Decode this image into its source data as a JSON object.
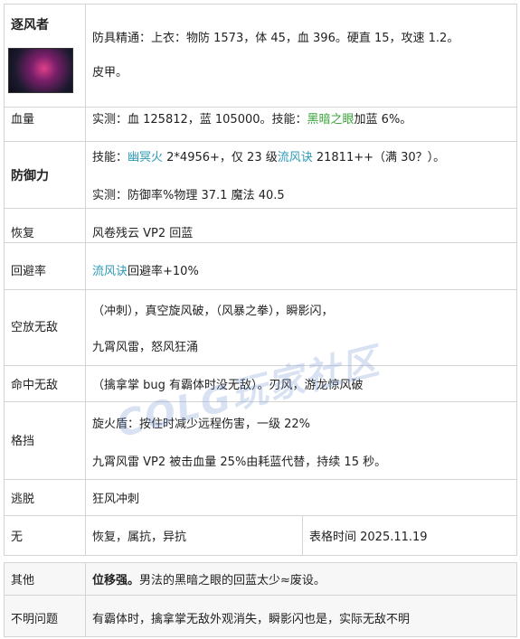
{
  "rows": [
    {
      "label": "逐风者",
      "lines": [
        [
          {
            "t": "防具精通：上衣：物防 1573，体 45，血 396。硬直 15，攻速 1.2。"
          }
        ],
        [
          {
            "t": "皮甲。"
          }
        ]
      ]
    },
    {
      "label": "血量",
      "lines": [
        [
          {
            "t": "实测：血 125812，蓝 105000。技能："
          },
          {
            "t": "黑暗之眼",
            "c": "hl-green"
          },
          {
            "t": "加蓝 6%。"
          }
        ]
      ]
    },
    {
      "label": "防御力",
      "lines": [
        [
          {
            "t": "技能："
          },
          {
            "t": "幽冥火",
            "c": "hl"
          },
          {
            "t": " 2*4956+，仅 23 级"
          },
          {
            "t": "流风诀",
            "c": "hl"
          },
          {
            "t": " 21811++（满 30？）。"
          }
        ],
        [
          {
            "t": "实测：防御率%物理 37.1 魔法 40.5"
          }
        ]
      ]
    },
    {
      "label": "恢复",
      "lines": [
        [
          {
            "t": "风卷残云 VP2 回蓝"
          }
        ]
      ]
    },
    {
      "label": "回避率",
      "lines": [
        [
          {
            "t": "流风诀",
            "c": "hl"
          },
          {
            "t": "回避率+10%"
          }
        ]
      ]
    },
    {
      "label": "空放无敌",
      "lines": [
        [
          {
            "t": "（冲刺），真空旋风破，（风暴之拳），瞬影闪，"
          }
        ],
        [
          {
            "t": "九霄风雷，怒风狂涌"
          }
        ]
      ]
    },
    {
      "label": "命中无敌",
      "lines": [
        [
          {
            "t": "（擒拿掌 bug 有霸体时没无敌）。刃风，游龙惊风破"
          }
        ]
      ]
    },
    {
      "label": "格挡",
      "lines": [
        [
          {
            "t": "旋火盾：按住时减少远程伤害，一级 22%"
          }
        ],
        [
          {
            "t": "九霄风雷 VP2 被击血量 25%由耗蓝代替，持续 15 秒。"
          }
        ]
      ]
    },
    {
      "label": "逃脱",
      "lines": [
        [
          {
            "t": "狂风冲刺"
          }
        ]
      ]
    },
    {
      "label": "无",
      "lines": [
        [
          {
            "t": "恢复，属抗，异抗"
          }
        ]
      ],
      "extra": "表格时间 2025.11.19"
    },
    {
      "label": "其他",
      "lines": [
        [
          {
            "t": "位移强。",
            "c": "bold"
          },
          {
            "t": "男法的黑暗之眼的回蓝太少≈废设。"
          }
        ]
      ]
    },
    {
      "label": "不明问题",
      "lines": [
        [
          {
            "t": "有霸体时，擒拿掌无敌外观消失，瞬影闪也是，实际无敌不明"
          }
        ]
      ]
    }
  ],
  "watermark": "COLG玩家社区"
}
